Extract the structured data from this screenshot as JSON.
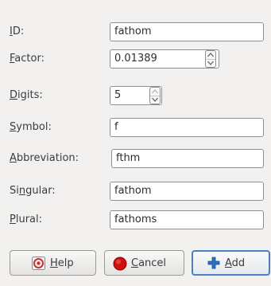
{
  "form": {
    "id": {
      "label_key": "I",
      "label_rest": "D:",
      "value": "fathom"
    },
    "factor": {
      "label_key": "F",
      "label_rest": "actor:",
      "value": "0.01389"
    },
    "digits": {
      "label_key": "D",
      "label_rest": "igits:",
      "value": "5"
    },
    "symbol": {
      "label_key": "S",
      "label_rest": "ymbol:",
      "value": "f"
    },
    "abbreviation": {
      "label_key": "A",
      "label_rest": "bbreviation:",
      "value": "fthm"
    },
    "singular": {
      "label_pre": "Si",
      "label_key": "n",
      "label_rest": "gular:",
      "value": "fathom"
    },
    "plural": {
      "label_key": "P",
      "label_rest": "lural:",
      "value": "fathoms"
    }
  },
  "buttons": {
    "help": {
      "key": "H",
      "rest": "elp",
      "icon": "help-icon"
    },
    "cancel": {
      "key": "C",
      "rest": "ancel",
      "icon": "cancel-icon"
    },
    "add": {
      "key": "A",
      "rest": "dd",
      "icon": "add-icon"
    }
  },
  "colors": {
    "background": "#f2f1f0",
    "focus_border": "#4a7fc1",
    "cancel_red": "#d01010",
    "add_blue": "#2d6fbf",
    "help_red": "#c83232"
  }
}
